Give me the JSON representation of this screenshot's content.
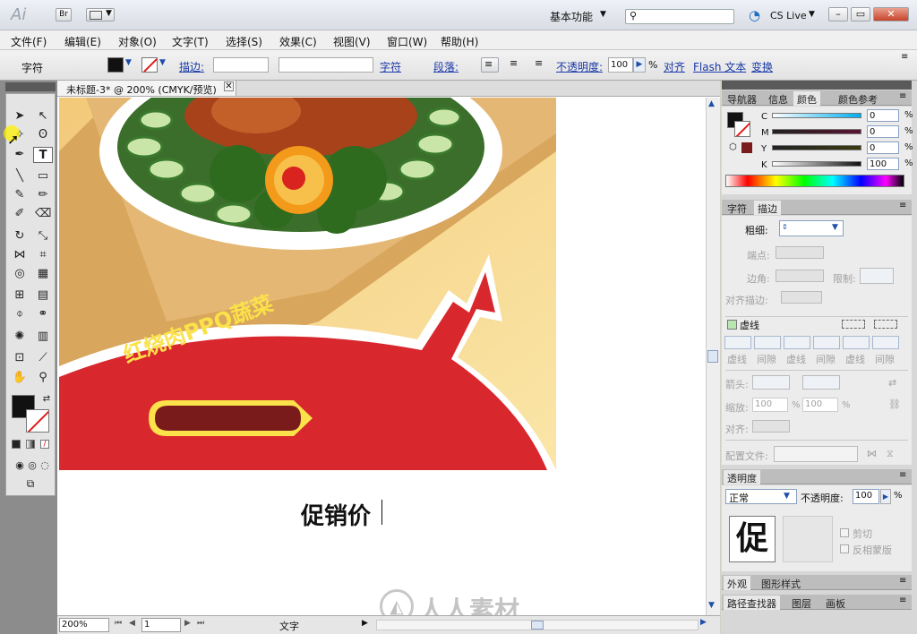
{
  "title_bar": {
    "app_logo": "Ai",
    "bridge_btn": "Br",
    "workspace": "基本功能",
    "cs_live": "CS Live"
  },
  "menu": [
    "文件(F)",
    "编辑(E)",
    "对象(O)",
    "文字(T)",
    "选择(S)",
    "效果(C)",
    "视图(V)",
    "窗口(W)",
    "帮助(H)"
  ],
  "control_bar": {
    "tool_label": "字符",
    "stroke_label": "描边:",
    "char_link": "字符",
    "para_link": "段落:",
    "opacity_link": "不透明度:",
    "opacity_value": "100",
    "opacity_unit": "%",
    "align_link": "对齐",
    "flash_link": "Flash 文本",
    "transform_link": "变换"
  },
  "document": {
    "tab_title": "未标题-3* @ 200% (CMYK/预览)",
    "headline": "红烧肉PPQ蔬菜",
    "promo_text": "促销价",
    "watermark": "人人素材"
  },
  "status_bar": {
    "zoom": "200%",
    "page": "1",
    "tool_status": "文字"
  },
  "panels": {
    "color_tabs": [
      "导航器",
      "信息",
      "颜色",
      "颜色参考"
    ],
    "cmyk": [
      {
        "label": "C",
        "value": "0"
      },
      {
        "label": "M",
        "value": "0"
      },
      {
        "label": "Y",
        "value": "0"
      },
      {
        "label": "K",
        "value": "100"
      }
    ],
    "percent": "%",
    "stroke_tabs": [
      "字符",
      "描边"
    ],
    "stroke": {
      "weight_label": "粗细:",
      "cap_label": "端点:",
      "corner_label": "边角:",
      "limit_label": "限制:",
      "align_label": "对齐描边:",
      "dashed_label": "虚线",
      "dash_labels": [
        "虚线",
        "间隙",
        "虚线",
        "间隙",
        "虚线",
        "间隙"
      ],
      "arrow_label": "箭头:",
      "scale_label": "缩放:",
      "scale_a": "100",
      "scale_b": "100",
      "align2_label": "对齐:",
      "profile_label": "配置文件:"
    },
    "transparency": {
      "tab": "透明度",
      "blend_mode": "正常",
      "opacity_label": "不透明度:",
      "opacity_value": "100",
      "thumb_char": "促",
      "clip_label": "剪切",
      "invert_label": "反相蒙版"
    },
    "appearance_tabs": [
      "外观",
      "图形样式"
    ],
    "bottom_tabs": [
      "路径查找器",
      "图层",
      "画板"
    ]
  },
  "colors": {
    "banner_red": "#d9272e",
    "headline_yellow": "#fbe14a",
    "pill_fill": "#7a1b1b"
  }
}
